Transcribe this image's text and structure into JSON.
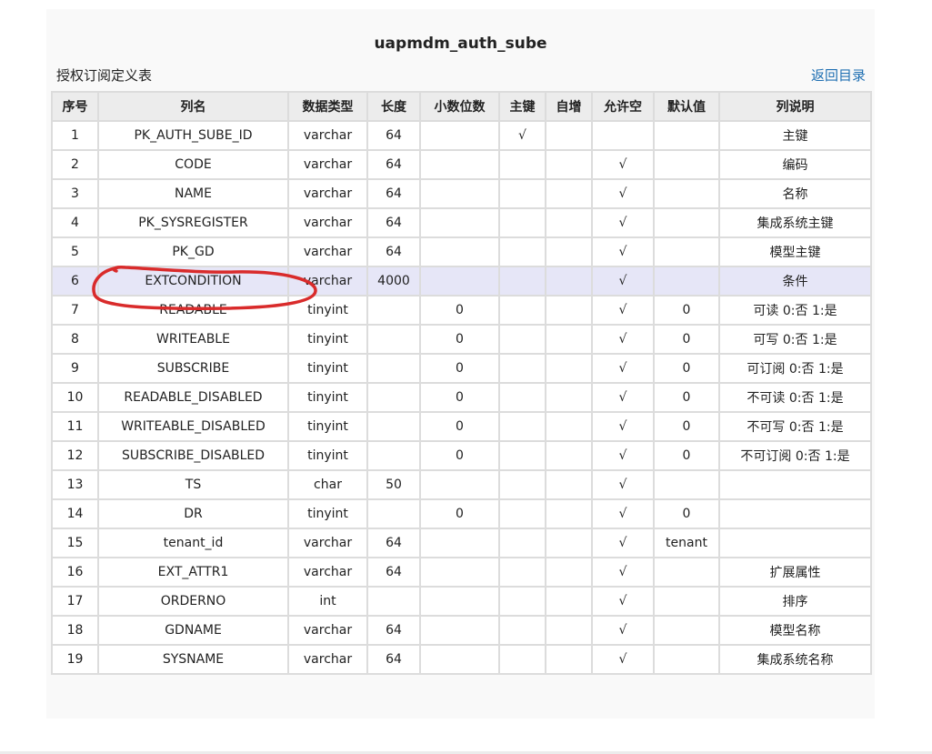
{
  "page": {
    "title": "uapmdm_auth_sube",
    "subtitle": "授权订阅定义表",
    "back_link": "返回目录"
  },
  "table": {
    "headers": [
      "序号",
      "列名",
      "数据类型",
      "长度",
      "小数位数",
      "主键",
      "自增",
      "允许空",
      "默认值",
      "列说明"
    ],
    "highlighted_row": 6,
    "rows": [
      [
        "1",
        "PK_AUTH_SUBE_ID",
        "varchar",
        "64",
        "",
        "√",
        "",
        "",
        "",
        "主键"
      ],
      [
        "2",
        "CODE",
        "varchar",
        "64",
        "",
        "",
        "",
        "√",
        "",
        "编码"
      ],
      [
        "3",
        "NAME",
        "varchar",
        "64",
        "",
        "",
        "",
        "√",
        "",
        "名称"
      ],
      [
        "4",
        "PK_SYSREGISTER",
        "varchar",
        "64",
        "",
        "",
        "",
        "√",
        "",
        "集成系统主键"
      ],
      [
        "5",
        "PK_GD",
        "varchar",
        "64",
        "",
        "",
        "",
        "√",
        "",
        "模型主键"
      ],
      [
        "6",
        "EXTCONDITION",
        "varchar",
        "4000",
        "",
        "",
        "",
        "√",
        "",
        "条件"
      ],
      [
        "7",
        "READABLE",
        "tinyint",
        "",
        "0",
        "",
        "",
        "√",
        "0",
        "可读 0:否 1:是"
      ],
      [
        "8",
        "WRITEABLE",
        "tinyint",
        "",
        "0",
        "",
        "",
        "√",
        "0",
        "可写 0:否 1:是"
      ],
      [
        "9",
        "SUBSCRIBE",
        "tinyint",
        "",
        "0",
        "",
        "",
        "√",
        "0",
        "可订阅 0:否 1:是"
      ],
      [
        "10",
        "READABLE_DISABLED",
        "tinyint",
        "",
        "0",
        "",
        "",
        "√",
        "0",
        "不可读 0:否 1:是"
      ],
      [
        "11",
        "WRITEABLE_DISABLED",
        "tinyint",
        "",
        "0",
        "",
        "",
        "√",
        "0",
        "不可写 0:否 1:是"
      ],
      [
        "12",
        "SUBSCRIBE_DISABLED",
        "tinyint",
        "",
        "0",
        "",
        "",
        "√",
        "0",
        "不可订阅 0:否 1:是"
      ],
      [
        "13",
        "TS",
        "char",
        "50",
        "",
        "",
        "",
        "√",
        "",
        ""
      ],
      [
        "14",
        "DR",
        "tinyint",
        "",
        "0",
        "",
        "",
        "√",
        "0",
        ""
      ],
      [
        "15",
        "tenant_id",
        "varchar",
        "64",
        "",
        "",
        "",
        "√",
        "tenant",
        ""
      ],
      [
        "16",
        "EXT_ATTR1",
        "varchar",
        "64",
        "",
        "",
        "",
        "√",
        "",
        "扩展属性"
      ],
      [
        "17",
        "ORDERNO",
        "int",
        "",
        "",
        "",
        "",
        "√",
        "",
        "排序"
      ],
      [
        "18",
        "GDNAME",
        "varchar",
        "64",
        "",
        "",
        "",
        "√",
        "",
        "模型名称"
      ],
      [
        "19",
        "SYSNAME",
        "varchar",
        "64",
        "",
        "",
        "",
        "√",
        "",
        "集成系统名称"
      ]
    ]
  },
  "annotation": {
    "color": "#d92b2b",
    "shape": "hand-drawn-ellipse"
  }
}
